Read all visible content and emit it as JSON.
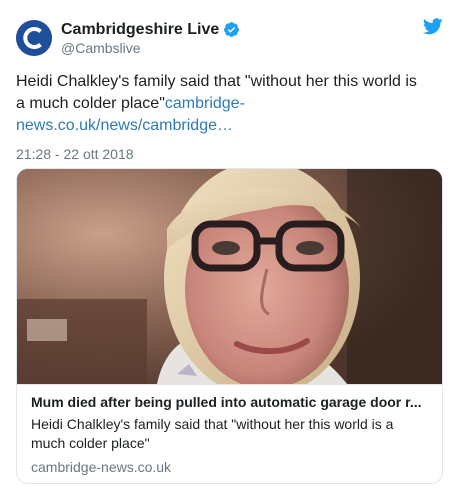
{
  "account": {
    "display_name": "Cambridgeshire Live",
    "handle": "@Cambslive",
    "avatar_letter": "C",
    "verified": true
  },
  "tweet": {
    "text": "Heidi Chalkley's family said that \"without her this world is a much colder place\"",
    "link_text": "cambridge-news.co.uk/news/cambridge…",
    "timestamp": "21:28 - 22 ott 2018"
  },
  "card": {
    "title": "Mum died after being pulled into automatic garage door r...",
    "description": "Heidi Chalkley's family said that \"without her this world is a much colder place\"",
    "domain": "cambridge-news.co.uk"
  },
  "icons": {
    "avatar": "cambridgeshire-live-logo",
    "verified": "verified-badge-icon",
    "platform": "twitter-bird-icon"
  },
  "colors": {
    "link": "#2b7bb9",
    "verified": "#1da1f2",
    "bird": "#1da1f2",
    "secondary_text": "#697882",
    "avatar_bg": "#1f4f9a"
  }
}
